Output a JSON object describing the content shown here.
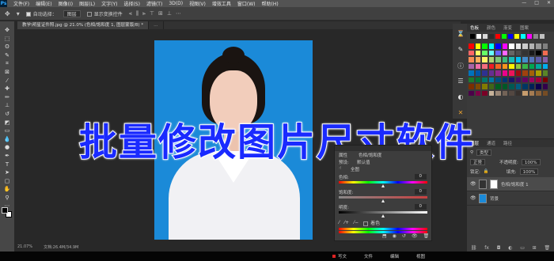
{
  "menubar": {
    "logo": "Ps",
    "items": [
      "文件(F)",
      "编辑(E)",
      "图像(I)",
      "图层(L)",
      "文字(Y)",
      "选择(S)",
      "滤镜(T)",
      "3D(D)",
      "视图(V)",
      "增效工具",
      "窗口(W)",
      "帮助(H)"
    ],
    "window_controls": [
      "—",
      "□",
      "✕"
    ]
  },
  "options": {
    "auto_select_label": "自动选择：",
    "auto_select_target": "图层",
    "show_transform_label": "显示变换控件"
  },
  "tabs": [
    {
      "label": "教学\\明星证件照.jpg @ 21.0% (色相/饱和度 1, 图层蒙版/8) *"
    },
    {
      "label": "…"
    }
  ],
  "status": {
    "zoom": "21.07%",
    "doc_info": "文档:26.4M/34.9M"
  },
  "overlay": {
    "headline": "批量修改图片尺寸软件"
  },
  "swatches": {
    "tabs": [
      "色板",
      "颜色",
      "渐变",
      "图案"
    ],
    "recent_colors": [
      "#000000",
      "#ffffff",
      "#d9d9d9",
      "#2b2b2b",
      "#ff0000",
      "#00ff00",
      "#0000ff",
      "#ffff00",
      "#00ffff",
      "#ff00ff",
      "#8a8a8a",
      "#c0c0c0"
    ],
    "grid_colors": [
      "#ff0000",
      "#ffff00",
      "#00ff00",
      "#00ffff",
      "#0000ff",
      "#ff00ff",
      "#ffffff",
      "#e6e6e6",
      "#cccccc",
      "#b3b3b3",
      "#999999",
      "#808080",
      "#ff6666",
      "#ffff66",
      "#66ff66",
      "#66ffff",
      "#6666ff",
      "#ff66ff",
      "#666666",
      "#4d4d4d",
      "#333333",
      "#1a1a1a",
      "#000000",
      "#f26c4f",
      "#f68e55",
      "#fbaf5c",
      "#fff467",
      "#acd372",
      "#7cc576",
      "#3bb878",
      "#1abbb4",
      "#00bff3",
      "#438ccb",
      "#5574b9",
      "#605ca8",
      "#855fa8",
      "#a763a8",
      "#f06ea9",
      "#f26d7d",
      "#ed1c24",
      "#f26522",
      "#f7941d",
      "#fff200",
      "#8dc73f",
      "#39b54a",
      "#00a651",
      "#00a99d",
      "#00aeef",
      "#0072bc",
      "#0054a6",
      "#2e3192",
      "#662d91",
      "#92278f",
      "#ec008c",
      "#ed145b",
      "#9e0b0f",
      "#a0410d",
      "#a36209",
      "#aba000",
      "#598527",
      "#1a7b30",
      "#007236",
      "#00746b",
      "#0076a3",
      "#004b80",
      "#003471",
      "#1b1464",
      "#440e62",
      "#630460",
      "#9e005d",
      "#9e0039",
      "#790000",
      "#7b2e00",
      "#7d4900",
      "#827b00",
      "#406618",
      "#005e20",
      "#005826",
      "#005952",
      "#005b7f",
      "#003663",
      "#002157",
      "#0d004c",
      "#32004b",
      "#4b0049",
      "#7b0046",
      "#7a0026",
      "#c7b299",
      "#998675",
      "#736357",
      "#534741",
      "#37302d",
      "#c69c6d",
      "#a67c52",
      "#8c6239",
      "#754c24"
    ]
  },
  "layers": {
    "tabs": [
      "图层",
      "通道",
      "路径"
    ],
    "filter_label": "类型",
    "blend_mode": "正常",
    "opacity_label": "不透明度:",
    "opacity_value": "100%",
    "lock_label": "锁定:",
    "fill_label": "填充:",
    "fill_value": "100%",
    "items": [
      {
        "name": "色相/饱和度 1",
        "selected": true
      },
      {
        "name": "背景",
        "selected": false
      }
    ]
  },
  "properties": {
    "title": "属性",
    "sub_label": "色相/饱和度",
    "preset_label": "预设:",
    "preset_value": "默认值",
    "channel_value": "全图",
    "hue_label": "色相:",
    "hue_value": "0",
    "hue_fraction": 0.5,
    "sat_label": "饱和度:",
    "sat_value": "0",
    "sat_fraction": 0.5,
    "light_label": "明度:",
    "light_value": "0",
    "light_fraction": 0.5,
    "colorize_label": "着色"
  },
  "taskbar": {
    "items": [
      "写文",
      "文件",
      "编辑",
      "视图"
    ]
  }
}
